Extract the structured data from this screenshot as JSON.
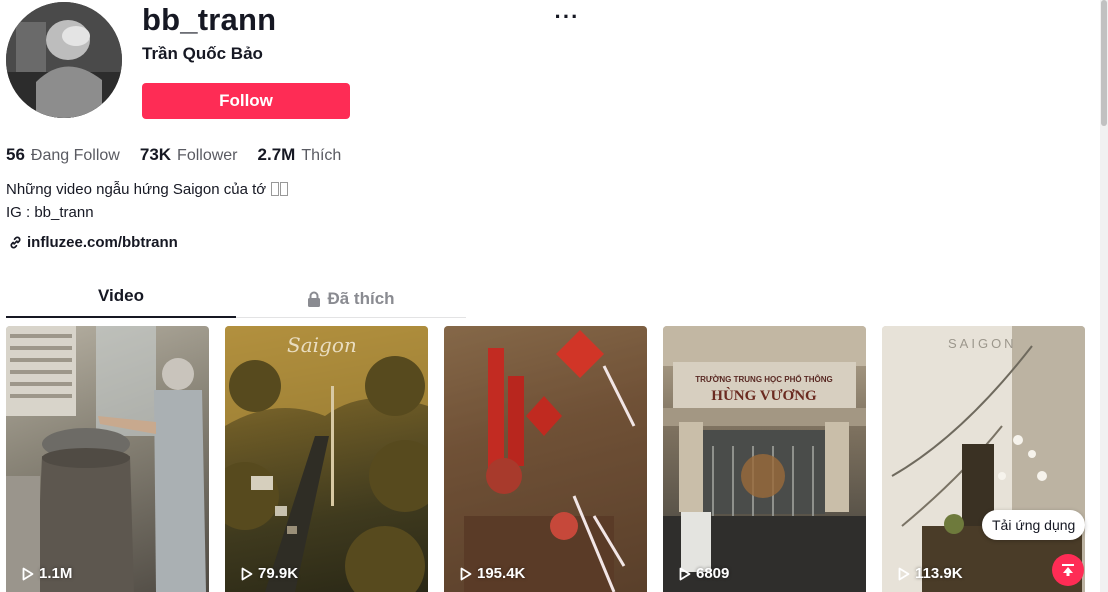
{
  "profile": {
    "username": "bb_trann",
    "display_name": "Trần Quốc Bảo",
    "follow_label": "Follow",
    "more_label": "···",
    "accent_color": "#fe2c55"
  },
  "stats": [
    {
      "value": "56",
      "label": "Đang Follow"
    },
    {
      "value": "73K",
      "label": "Follower"
    },
    {
      "value": "2.7M",
      "label": "Thích"
    }
  ],
  "bio": {
    "line1": "Những video ngẫu hứng Saigon của tớ",
    "line2": "IG : bb_trann"
  },
  "link": {
    "text": "influzee.com/bbtrann",
    "icon": "link-icon"
  },
  "tabs": [
    {
      "label": "Video",
      "active": true
    },
    {
      "label": "Đã thích",
      "icon": "lock-icon"
    }
  ],
  "videos": [
    {
      "views": "1.1M"
    },
    {
      "views": "79.9K"
    },
    {
      "views": "195.4K"
    },
    {
      "views": "6809"
    },
    {
      "views": "113.9K"
    }
  ],
  "thumbnail_text": {
    "v2": "Saigon",
    "v4_line1": "TRƯỜNG TRUNG HỌC PHỔ THÔNG",
    "v4_line2": "HÙNG VƯƠNG",
    "v5": "SAIGON"
  },
  "floating": {
    "get_app_label": "Tải ứng dụng",
    "back_to_top_icon": "arrow-up-icon"
  }
}
